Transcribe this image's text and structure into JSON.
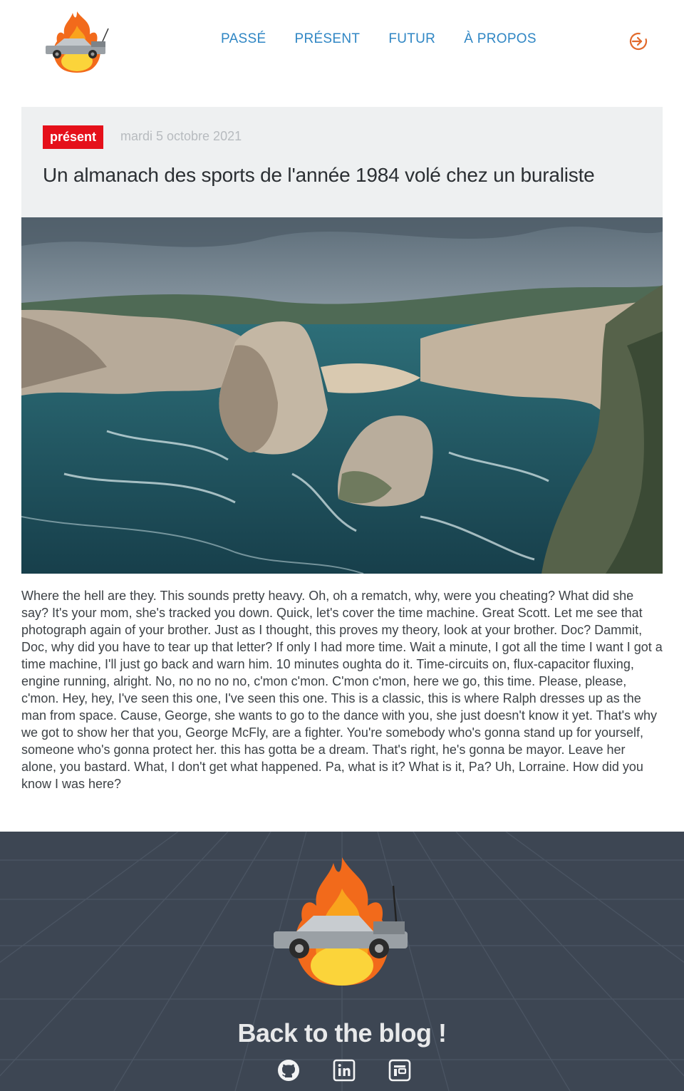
{
  "nav": {
    "items": [
      {
        "label": "PASSÉ"
      },
      {
        "label": "PRÉSENT"
      },
      {
        "label": "FUTUR"
      },
      {
        "label": "À PROPOS"
      }
    ],
    "accent": "#2f86c4",
    "login_icon": "login-arrow-icon",
    "login_color": "#e26a2c"
  },
  "article": {
    "category": "présent",
    "category_color": "#e5101a",
    "date": "mardi 5 octobre 2021",
    "title": "Un almanach des sports de l'année 1984 volé chez un buraliste",
    "image": "coastal-cliffs-photo",
    "body": "Where the hell are they. This sounds pretty heavy. Oh, oh a rematch, why, were you cheating? What did she say? It's your mom, she's tracked you down. Quick, let's cover the time machine. Great Scott. Let me see that photograph again of your brother. Just as I thought, this proves my theory, look at your brother. Doc? Dammit, Doc, why did you have to tear up that letter? If only I had more time. Wait a minute, I got all the time I want I got a time machine, I'll just go back and warn him. 10 minutes oughta do it. Time-circuits on, flux-capacitor fluxing, engine running, alright. No, no no no no, c'mon c'mon. C'mon c'mon, here we go, this time. Please, please, c'mon. Hey, hey, I've seen this one, I've seen this one. This is a classic, this is where Ralph dresses up as the man from space. Cause, George, she wants to go to the dance with you, she just doesn't know it yet. That's why we got to show her that you, George McFly, are a fighter. You're somebody who's gonna stand up for yourself, someone who's gonna protect her. this has gotta be a dream. That's right, he's gonna be mayor. Leave her alone, you bastard. What, I don't get what happened. Pa, what is it? What is it, Pa? Uh, Lorraine. How did you know I was here?"
  },
  "footer": {
    "back_label": "Back to the blog !",
    "socials": [
      "github-icon",
      "linkedin-icon",
      "portfolio-icon"
    ],
    "background": "#3d4653"
  }
}
